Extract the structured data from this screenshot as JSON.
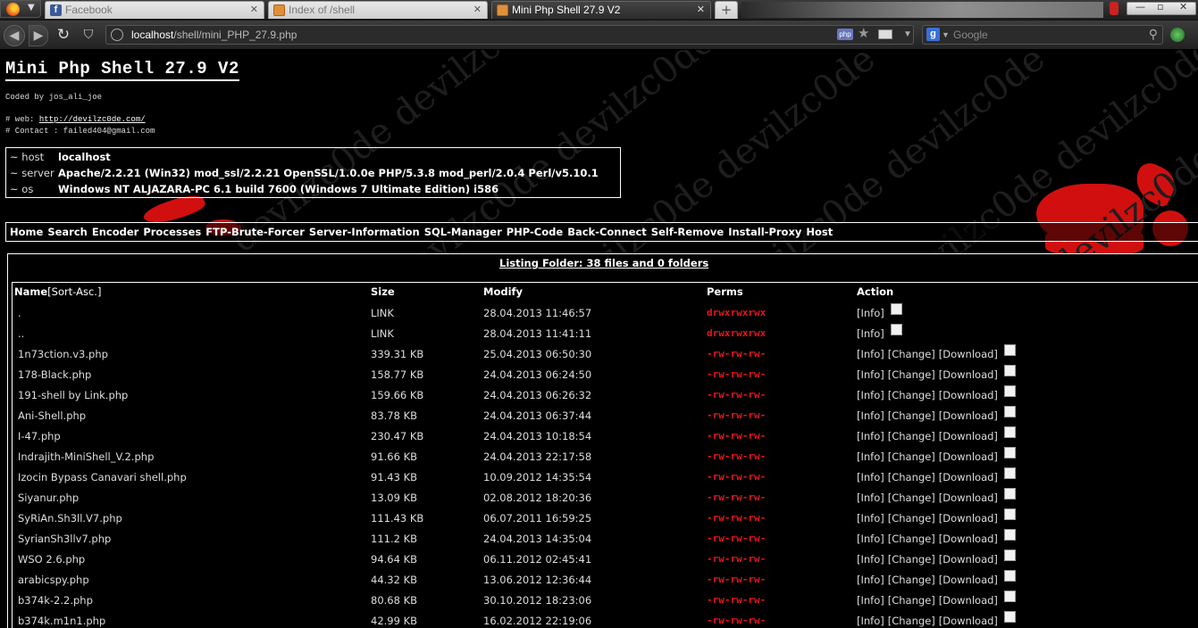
{
  "browser": {
    "tabs": [
      {
        "title": "Facebook",
        "active": false,
        "icon": "facebook-icon"
      },
      {
        "title": "Index of /shell",
        "active": false,
        "icon": "page-icon"
      },
      {
        "title": "Mini Php Shell 27.9 V2",
        "active": true,
        "icon": "page-icon"
      }
    ],
    "url_host": "localhost",
    "url_path": "/shell/mini_PHP_27.9.php",
    "php_badge": "php",
    "search_placeholder": "Google"
  },
  "shell": {
    "title": "Mini Php Shell 27.9 V2",
    "coded_by": "Coded by jos_ali_joe",
    "web_label": "# web: ",
    "web_link": "http://devilzc0de.com/",
    "contact": "# Contact : failed404@gmail.com",
    "watermark_text": "devilzc0de devilzc0de"
  },
  "info": [
    {
      "key": "~ host",
      "value": "localhost"
    },
    {
      "key": "~ server",
      "value": "Apache/2.2.21 (Win32) mod_ssl/2.2.21 OpenSSL/1.0.0e PHP/5.3.8 mod_perl/2.0.4 Perl/v5.10.1"
    },
    {
      "key": "~ os",
      "value": "Windows NT ALJAZARA-PC 6.1 build 7600 (Windows 7 Ultimate Edition) i586"
    }
  ],
  "menu": [
    "Home",
    "Search",
    "Encoder",
    "Processes",
    "FTP-Brute-Forcer",
    "Server-Information",
    "SQL-Manager",
    "PHP-Code",
    "Back-Connect",
    "Self-Remove",
    "Install-Proxy",
    "Host"
  ],
  "listing": {
    "title": "Listing Folder: 38 files and 0 folders",
    "headers": {
      "name": "Name",
      "sort": "[Sort-Asc.]",
      "size": "Size",
      "modify": "Modify",
      "perms": "Perms",
      "action": "Action"
    },
    "action_labels": {
      "info": "[Info]",
      "change": "[Change]",
      "download": "[Download]"
    },
    "rows": [
      {
        "name": ".",
        "size": "LINK",
        "modify": "28.04.2013 11:46:57",
        "perms": "drwxrwxrwx",
        "full": false
      },
      {
        "name": "..",
        "size": "LINK",
        "modify": "28.04.2013 11:41:11",
        "perms": "drwxrwxrwx",
        "full": false
      },
      {
        "name": "1n73ction.v3.php",
        "size": "339.31 KB",
        "modify": "25.04.2013 06:50:30",
        "perms": "-rw-rw-rw-",
        "full": true
      },
      {
        "name": "178-Black.php",
        "size": "158.77 KB",
        "modify": "24.04.2013 06:24:50",
        "perms": "-rw-rw-rw-",
        "full": true
      },
      {
        "name": "191-shell by Link.php",
        "size": "159.66 KB",
        "modify": "24.04.2013 06:26:32",
        "perms": "-rw-rw-rw-",
        "full": true
      },
      {
        "name": "Ani-Shell.php",
        "size": "83.78 KB",
        "modify": "24.04.2013 06:37:44",
        "perms": "-rw-rw-rw-",
        "full": true
      },
      {
        "name": "I-47.php",
        "size": "230.47 KB",
        "modify": "24.04.2013 10:18:54",
        "perms": "-rw-rw-rw-",
        "full": true
      },
      {
        "name": "Indrajith-MiniShell_V.2.php",
        "size": "91.66 KB",
        "modify": "24.04.2013 22:17:58",
        "perms": "-rw-rw-rw-",
        "full": true
      },
      {
        "name": "Izocin Bypass Canavari shell.php",
        "size": "91.43 KB",
        "modify": "10.09.2012 14:35:54",
        "perms": "-rw-rw-rw-",
        "full": true
      },
      {
        "name": "Siyanur.php",
        "size": "13.09 KB",
        "modify": "02.08.2012 18:20:36",
        "perms": "-rw-rw-rw-",
        "full": true
      },
      {
        "name": "SyRiAn.Sh3ll.V7.php",
        "size": "111.43 KB",
        "modify": "06.07.2011 16:59:25",
        "perms": "-rw-rw-rw-",
        "full": true
      },
      {
        "name": "SyrianSh3llv7.php",
        "size": "111.2 KB",
        "modify": "24.04.2013 14:35:04",
        "perms": "-rw-rw-rw-",
        "full": true
      },
      {
        "name": "WSO 2.6.php",
        "size": "94.64 KB",
        "modify": "06.11.2012 02:45:41",
        "perms": "-rw-rw-rw-",
        "full": true
      },
      {
        "name": "arabicspy.php",
        "size": "44.32 KB",
        "modify": "13.06.2012 12:36:44",
        "perms": "-rw-rw-rw-",
        "full": true
      },
      {
        "name": "b374k-2.2.php",
        "size": "80.68 KB",
        "modify": "30.10.2012 18:23:06",
        "perms": "-rw-rw-rw-",
        "full": true
      },
      {
        "name": "b374k.m1n1.php",
        "size": "42.99 KB",
        "modify": "16.02.2012 22:19:06",
        "perms": "-rw-rw-rw-",
        "full": true
      }
    ]
  },
  "colors": {
    "perms": "#e3161b",
    "accent_red": "#d10f0f",
    "background": "#000000"
  }
}
